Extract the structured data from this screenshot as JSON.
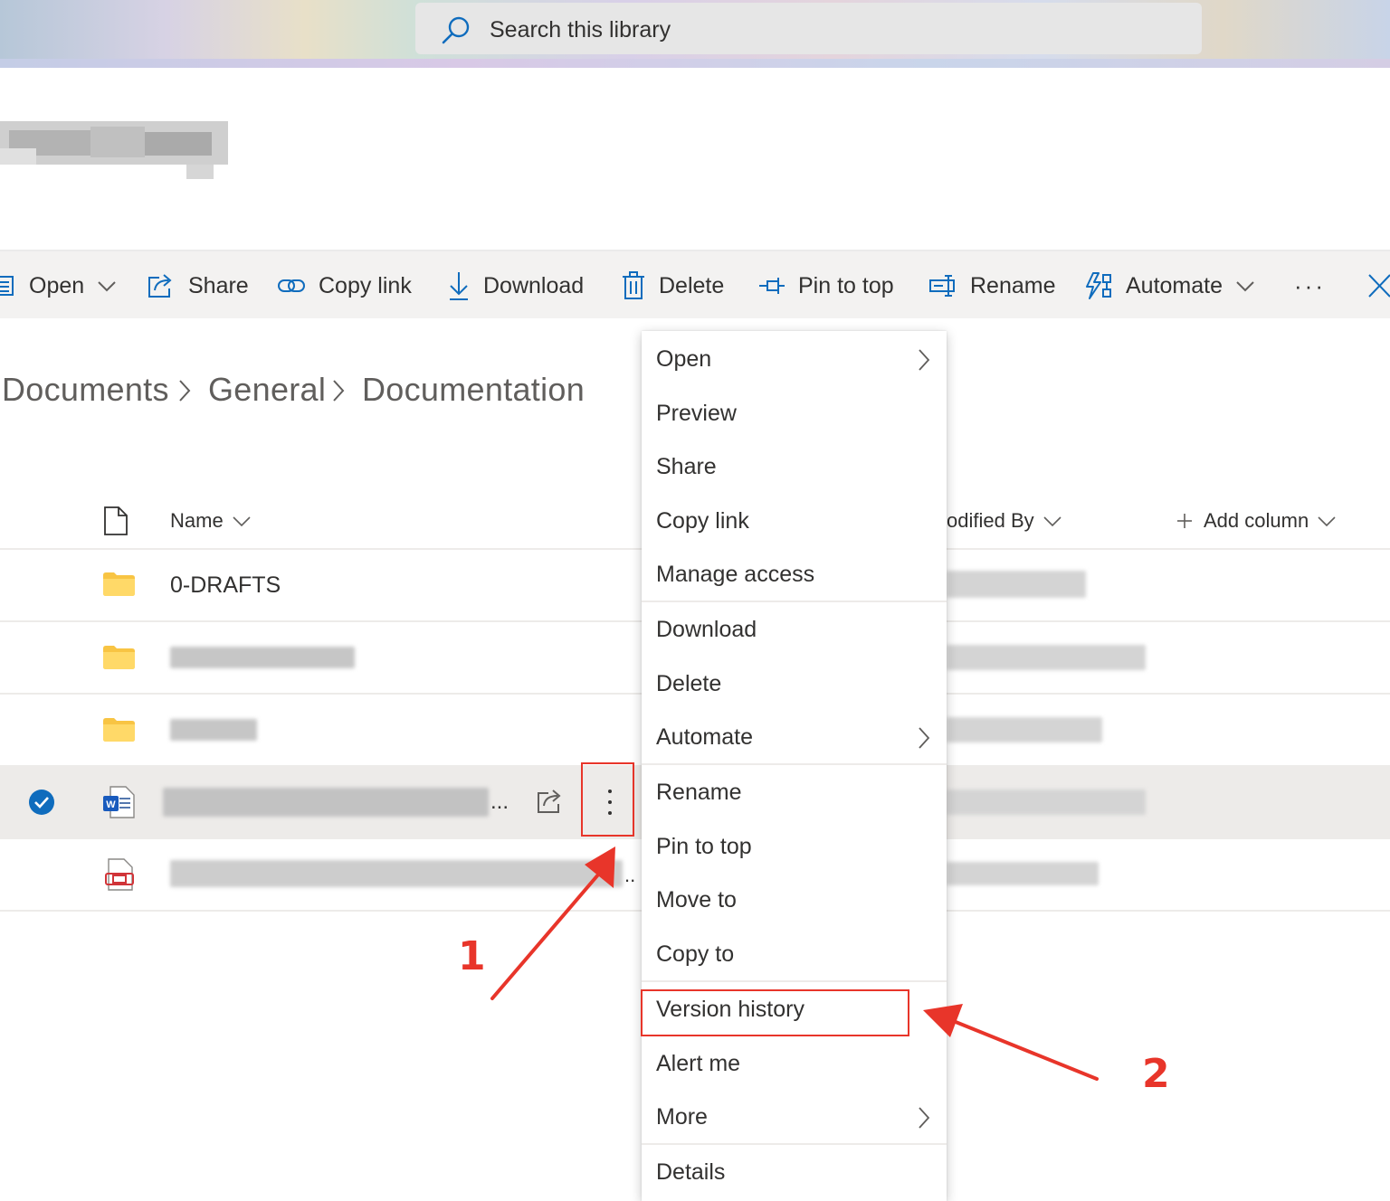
{
  "search": {
    "placeholder": "Search this library"
  },
  "toolbar": {
    "open": "Open",
    "share": "Share",
    "copy_link": "Copy link",
    "download": "Download",
    "delete": "Delete",
    "pin_to_top": "Pin to top",
    "rename": "Rename",
    "automate": "Automate",
    "more": "···"
  },
  "breadcrumb": [
    "Documents",
    "General",
    "Documentation"
  ],
  "columns": {
    "name": "Name",
    "modified_by": "odified By",
    "add_column": "Add column"
  },
  "rows": [
    {
      "name": "0-DRAFTS",
      "type": "folder"
    },
    {
      "name": "",
      "type": "folder"
    },
    {
      "name": "",
      "type": "folder"
    },
    {
      "name": "",
      "type": "word",
      "truncation": "...",
      "selected": true
    },
    {
      "name": "",
      "type": "pdf",
      "truncation": ".."
    }
  ],
  "context_menu": {
    "items": [
      {
        "label": "Open",
        "submenu": true
      },
      {
        "label": "Preview"
      },
      {
        "label": "Share"
      },
      {
        "label": "Copy link"
      },
      {
        "label": "Manage access"
      },
      {
        "label": "Download"
      },
      {
        "label": "Delete"
      },
      {
        "label": "Automate",
        "submenu": true
      },
      {
        "label": "Rename"
      },
      {
        "label": "Pin to top"
      },
      {
        "label": "Move to"
      },
      {
        "label": "Copy to"
      },
      {
        "label": "Version history"
      },
      {
        "label": "Alert me"
      },
      {
        "label": "More",
        "submenu": true
      },
      {
        "label": "Details"
      }
    ]
  },
  "annotations": {
    "step1": "1",
    "step2": "2"
  },
  "colors": {
    "accent": "#0078d4",
    "annotation": "#e8352a",
    "folder": "#ffd968"
  }
}
